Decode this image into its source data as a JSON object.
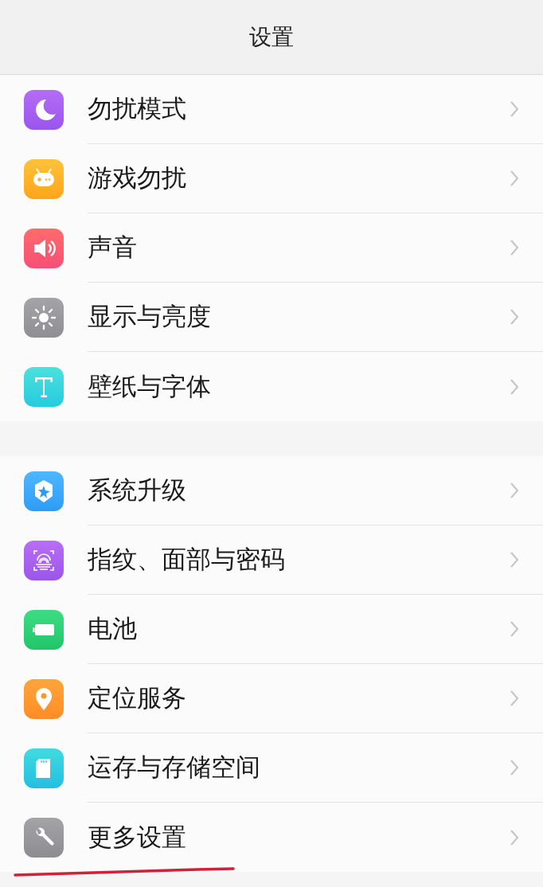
{
  "header": {
    "title": "设置"
  },
  "groups": [
    {
      "items": [
        {
          "label": "勿扰模式",
          "kind": "moon"
        },
        {
          "label": "游戏勿扰",
          "kind": "gamepad"
        },
        {
          "label": "声音",
          "kind": "speaker"
        },
        {
          "label": "显示与亮度",
          "kind": "sun"
        },
        {
          "label": "壁纸与字体",
          "kind": "font"
        }
      ]
    },
    {
      "items": [
        {
          "label": "系统升级",
          "kind": "update"
        },
        {
          "label": "指纹、面部与密码",
          "kind": "fingerprint"
        },
        {
          "label": "电池",
          "kind": "battery"
        },
        {
          "label": "定位服务",
          "kind": "location"
        },
        {
          "label": "运存与存储空间",
          "kind": "storage"
        },
        {
          "label": "更多设置",
          "kind": "wrench"
        }
      ]
    }
  ],
  "annotation": {
    "kind": "underline"
  }
}
